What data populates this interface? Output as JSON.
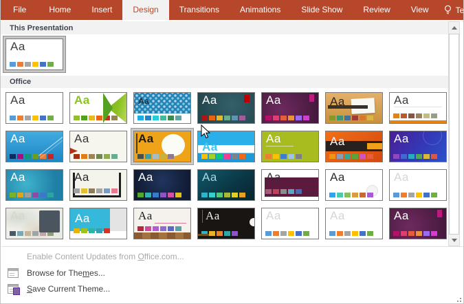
{
  "ribbon": {
    "tabs": [
      {
        "label": "File"
      },
      {
        "label": "Home"
      },
      {
        "label": "Insert"
      },
      {
        "label": "Design",
        "selected": true
      },
      {
        "label": "Transitions"
      },
      {
        "label": "Animations"
      },
      {
        "label": "Slide Show"
      },
      {
        "label": "Review"
      },
      {
        "label": "View"
      }
    ],
    "tellme_label": "Tel"
  },
  "sections": {
    "this_presentation": {
      "title": "This Presentation"
    },
    "office": {
      "title": "Office"
    }
  },
  "gallery": {
    "aa_label": "Aa",
    "this_presentation_themes": [
      {
        "decor": "d-office",
        "state": "selected",
        "bg": "#ffffff",
        "aa": "#3f3f3f",
        "swatches": [
          "#5B9BD5",
          "#ED7D31",
          "#A5A5A5",
          "#FFC000",
          "#4472C4",
          "#70AD47"
        ]
      }
    ],
    "office_themes": [
      {
        "decor": "d-office",
        "bg": "#ffffff",
        "aa": "#3f3f3f",
        "swatches": [
          "#5B9BD5",
          "#ED7D31",
          "#A5A5A5",
          "#FFC000",
          "#4472C4",
          "#70AD47"
        ]
      },
      {
        "decor": "d-facet",
        "bg": "#ffffff",
        "aa": "#8CC220",
        "swatches": [
          "#90C226",
          "#54A021",
          "#E6B91E",
          "#E76618",
          "#C42F1A",
          "#918655"
        ]
      },
      {
        "decor": "d-integral",
        "bg": "#ffffff",
        "aa": "#1a2e38",
        "swatches": [
          "#1CADE4",
          "#2683C6",
          "#27CED7",
          "#42BA97",
          "#3E8853",
          "#62A39F"
        ]
      },
      {
        "decor": "d-ion",
        "bg": "radial-gradient(circle at 60% 40%, #33606a, #224249)",
        "aa": "#ffffff",
        "swatches": [
          "#B01513",
          "#EA6312",
          "#E6B729",
          "#6AAC90",
          "#5F93B4",
          "#9E5E9B"
        ]
      },
      {
        "decor": "d-ionboard",
        "bg": "radial-gradient(circle at 35% 60%, #6e2a5e, #401739)",
        "aa": "#ffffff",
        "swatches": [
          "#B31166",
          "#E33D6F",
          "#E45F3C",
          "#E9943A",
          "#9B6BF2",
          "#D53DD0"
        ]
      },
      {
        "decor": "d-organic",
        "bg": "linear-gradient(180deg,#e5b168,#c8913f)",
        "aa": "#2a2520",
        "swatches": [
          "#83992A",
          "#3C9770",
          "#44709D",
          "#A23C33",
          "#D97828",
          "#DEB340"
        ]
      },
      {
        "decor": "d-retrospect",
        "bg": "#ffffff",
        "aa": "#3f3f3f",
        "swatches": [
          "#E48312",
          "#BD582C",
          "#865640",
          "#9B8357",
          "#C2BC80",
          "#94A088"
        ]
      },
      {
        "decor": "d-slice",
        "bg": "linear-gradient(180deg,#41ace0,#1f86c5)",
        "aa": "#ffffff",
        "swatches": [
          "#052F61",
          "#A50E82",
          "#14967C",
          "#6A9E1F",
          "#E87D37",
          "#C62324"
        ]
      },
      {
        "decor": "d-wisp",
        "bg": "#f7f6ee",
        "aa": "#3a3a3a",
        "swatches": [
          "#A53010",
          "#DE7E18",
          "#9F8351",
          "#728653",
          "#92AA4C",
          "#6AAC91"
        ]
      },
      {
        "decor": "d-crop",
        "state": "hovered",
        "bg": "#efa319",
        "aa": "#1e1a14",
        "swatches": [
          "#4a4e44",
          "#3e9ca3",
          "#a8bcc4",
          "#c3b43e",
          "#8e7a8f"
        ]
      },
      {
        "decor": "d-banded",
        "bg": "linear-gradient(180deg,#2bafe8 0%,#2bafe8 45%,#ffffff 45%,#ffffff 72%,#1e9ad6 72%)",
        "aa": "#3ec6f2",
        "swatches": [
          "#FFC000",
          "#A5D028",
          "#08CC78",
          "#F24099",
          "#828288",
          "#F56617"
        ]
      },
      {
        "decor": "d-lime",
        "bg": "#a8bc20",
        "aa": "#ffffff",
        "swatches": [
          "#ED7D31",
          "#FFC000",
          "#3E7DCC",
          "#9DC3E6",
          "#808080"
        ]
      },
      {
        "decor": "d-berlin",
        "bg": "linear-gradient(135deg,#f07018,#d6490f)",
        "aa": "#ffffff",
        "swatches": [
          "#F09415",
          "#8A9EB5",
          "#35A88F",
          "#5AA53A",
          "#CF52C8",
          "#E85D3A"
        ]
      },
      {
        "decor": "d-celestial",
        "bg": "linear-gradient(125deg,#4a1e96,#3438b8 55%,#2a52c9)",
        "aa": "#ffffff",
        "swatches": [
          "#8F48C2",
          "#4467D4",
          "#2BA8C4",
          "#53A74E",
          "#D8B93E",
          "#D85948"
        ]
      },
      {
        "decor": "d-quotable",
        "bg": "radial-gradient(circle at 35% 45%,#3fb3ce,#1f7fa6 75%)",
        "aa": "#ffffff",
        "swatches": [
          "#7CB228",
          "#E2A317",
          "#9E9E9E",
          "#8F4AA5",
          "#3B78C9",
          "#2BA5A0"
        ]
      },
      {
        "decor": "d-frame",
        "bg": "#f5f4ec",
        "aa": "#2a2a2a",
        "swatches": [
          "#9E9E9E",
          "#E0C030",
          "#8F7A5A",
          "#A5A5A5",
          "#7A9EC0",
          "#E87A8F"
        ]
      },
      {
        "decor": "d-navy",
        "bg": "radial-gradient(circle at 50% 35%,#20355e,#111b33 80%)",
        "aa": "#ffffff",
        "swatches": [
          "#52A52E",
          "#2BB5B0",
          "#3A7AC9",
          "#8F52C9",
          "#D052A5",
          "#E0C020"
        ]
      },
      {
        "decor": "d-parcel",
        "bg": "linear-gradient(145deg,#11596b,#0a3542 60%,#072630)",
        "aa": "#a8d8df",
        "swatches": [
          "#2AB5C9",
          "#35D0C9",
          "#52C97A",
          "#A5B83A",
          "#E0D020",
          "#E8A020"
        ]
      },
      {
        "decor": "d-mesh",
        "bg": "#ffffff",
        "aa": "#3a2a33",
        "swatches": [
          "#A85A78",
          "#C2434F",
          "#8C8C8C",
          "#55A8C2",
          "#4A6AB5"
        ]
      },
      {
        "decor": "d-droplet",
        "bg": "#ffffff",
        "aa": "#2e2e2e",
        "swatches": [
          "#2FA3EE",
          "#4BCAAD",
          "#86C157",
          "#D99C3F",
          "#CE6633",
          "#A35DD1"
        ]
      },
      {
        "decor": "d-office",
        "bg": "#ffffff",
        "aa": "#d6d6d6",
        "swatches": [
          "#5B9BD5",
          "#ED7D31",
          "#A5A5A5",
          "#FFC000",
          "#4472C4",
          "#70AD47"
        ]
      },
      {
        "decor": "d-feathered",
        "bg": "radial-gradient(ellipse at 20% 30%, rgba(150,180,170,.35), transparent 40%), radial-gradient(ellipse at 55% 70%, rgba(190,170,140,.35), transparent 40%), linear-gradient(120deg,#f4f1e8,#e7e9e3)",
        "aa": "#d8d5c8",
        "swatches": [
          "#4A5A66",
          "#7AA8B5",
          "#C2B59B",
          "#9EA5A8",
          "#BFA5A5",
          "#8F9E78"
        ]
      },
      {
        "decor": "d-cyanblock",
        "bg": "#ffffff",
        "aa": "#ffffff",
        "swatches": [
          "#F0B000",
          "#A0C020",
          "#2BB5A0",
          "#35A0B5",
          "#D0342C"
        ]
      },
      {
        "decor": "d-gallery",
        "bg": "#f5f2ee",
        "aa": "#1e1e1e",
        "swatches": [
          "#AD2A3F",
          "#D0499B",
          "#B559D6",
          "#8F6BD6",
          "#5A6AC2",
          "#5AA0A8"
        ]
      },
      {
        "decor": "d-mainevent",
        "bg": "#181512",
        "aa": "#eeeeee",
        "swatches": [
          "#2BB5C9",
          "#E8B52A",
          "#E8842B",
          "#35A5A5",
          "#8F52C9"
        ]
      },
      {
        "decor": "d-office",
        "bg": "#ffffff",
        "aa": "#d6d6d6",
        "swatches": [
          "#5B9BD5",
          "#ED7D31",
          "#A5A5A5",
          "#FFC000",
          "#4472C4",
          "#70AD47"
        ]
      },
      {
        "decor": "d-office",
        "bg": "#ffffff",
        "aa": "#d6d6d6",
        "swatches": [
          "#5B9BD5",
          "#ED7D31",
          "#A5A5A5",
          "#FFC000",
          "#4472C4",
          "#70AD47"
        ]
      },
      {
        "decor": "d-ionboard",
        "bg": "radial-gradient(circle at 35% 60%, #6e2a5e, #401739)",
        "aa": "#ffffff",
        "swatches": [
          "#B31166",
          "#E33D6F",
          "#E45F3C",
          "#E9943A",
          "#9B6BF2",
          "#D53DD0"
        ]
      }
    ]
  },
  "footer": {
    "enable_updates": {
      "pre": "Enable Content Updates from ",
      "u": "O",
      "post": "ffice.com..."
    },
    "browse": {
      "pre": "Browse for The",
      "u": "m",
      "post": "es..."
    },
    "save": {
      "pre": "",
      "u": "S",
      "post": "ave Current Theme..."
    }
  },
  "colors": {
    "ribbon": "#B7472A",
    "band": "#f2f2f2",
    "thumb_border": "#7a7a7a",
    "retrospect_bar": "#E48312",
    "disabled_text": "#a9a9a9"
  }
}
